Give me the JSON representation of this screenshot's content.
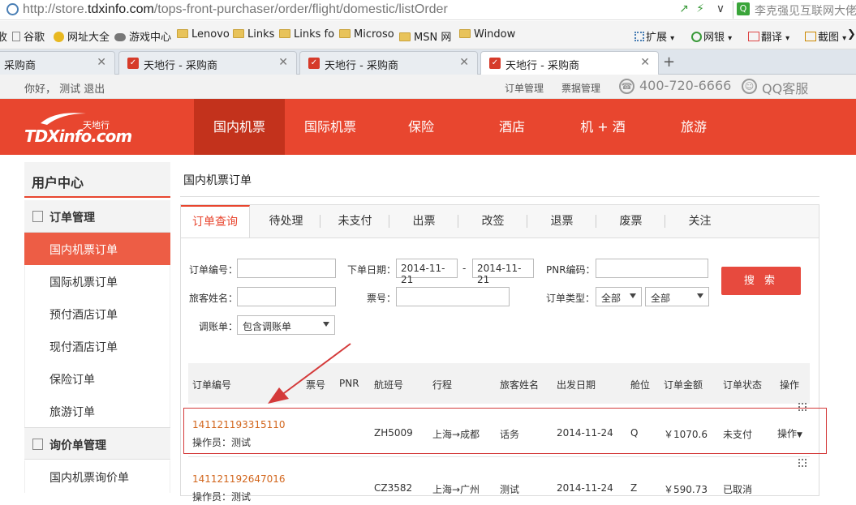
{
  "browser": {
    "url_prefix": "http://store.",
    "url_domain": "tdxinfo.com",
    "url_path": "/tops-front-purchaser/order/flight/domestic/listOrder",
    "search_text": "李克强见互联网大佬"
  },
  "bookmarks": {
    "items": [
      "谷歌",
      "网址大全",
      "游戏中心",
      "Lenovo",
      "Links",
      "Links fo",
      "Microso",
      "MSN 网",
      "Window"
    ],
    "right": [
      "扩展",
      "网银",
      "翻译",
      "截图"
    ]
  },
  "tabs": {
    "items": [
      "采购商",
      "天地行 - 采购商",
      "天地行 - 采购商",
      "天地行 - 采购商"
    ]
  },
  "topbar": {
    "greeting": "你好， 测试 退出",
    "order_mgmt": "订单管理",
    "ticket_mgmt": "票据管理",
    "phone": "400-720-6666",
    "qq": "QQ客服"
  },
  "logo": {
    "word": "TDXinfo.com",
    "cn": "天地行"
  },
  "nav": {
    "items": [
      "国内机票",
      "国际机票",
      "保险",
      "酒店",
      "机 + 酒",
      "旅游"
    ]
  },
  "sidebar": {
    "header": "用户中心",
    "group1": "订单管理",
    "items1": [
      "国内机票订单",
      "国际机票订单",
      "预付酒店订单",
      "现付酒店订单",
      "保险订单",
      "旅游订单"
    ],
    "group2": "询价单管理",
    "items2": [
      "国内机票询价单"
    ]
  },
  "main": {
    "title": "国内机票订单",
    "tabs": [
      "订单查询",
      "待处理",
      "未支付",
      "出票",
      "改签",
      "退票",
      "废票",
      "关注"
    ]
  },
  "filters": {
    "order_no_label": "订单编号：",
    "order_date_label": "下单日期：",
    "date_from": "2014-11-21",
    "date_dash": "-",
    "date_to": "2014-11-21",
    "pnr_label": "PNR编码：",
    "passenger_label": "旅客姓名：",
    "ticket_label": "票号：",
    "order_type_label": "订单类型：",
    "order_type_value1": "全部",
    "order_type_value2": "全部",
    "adjust_label": "调账单：",
    "adjust_value": "包含调账单",
    "search_button": "搜 索"
  },
  "table": {
    "headers": [
      "订单编号",
      "票号",
      "PNR",
      "航班号",
      "行程",
      "旅客姓名",
      "出发日期",
      "舱位",
      "订单金额",
      "订单状态",
      "操作"
    ],
    "rows": [
      {
        "order_no": "141121193315110",
        "operator": "操作员：测试",
        "flight": "ZH5009",
        "route": "上海→成都",
        "passenger": "话务",
        "date": "2014-11-24",
        "cabin": "Q",
        "amount": "￥1070.6",
        "status": "未支付",
        "action": "操作"
      },
      {
        "order_no": "141121192647016",
        "operator": "操作员：测试",
        "flight": "CZ3582",
        "route": "上海→广州",
        "passenger": "测试",
        "date": "2014-11-24",
        "cabin": "Z",
        "amount": "￥590.73",
        "status": "已取消",
        "action": ""
      }
    ]
  },
  "colors": {
    "brand": "#e8462f",
    "brand_dark": "#c3321c",
    "order_no": "#d2661d",
    "highlight": "#d43a3a"
  }
}
